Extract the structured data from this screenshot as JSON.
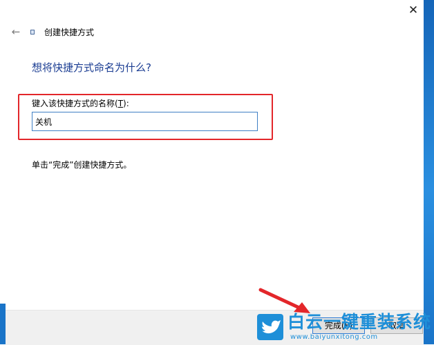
{
  "window": {
    "title": "创建快捷方式",
    "close_glyph": "✕",
    "back_glyph": "←"
  },
  "main": {
    "heading": "想将快捷方式命名为什么?",
    "field_label_pre": "键入该快捷方式的名称(",
    "field_label_key": "T",
    "field_label_post": "):",
    "name_value": "关机",
    "hint": "单击“完成”创建快捷方式。"
  },
  "footer": {
    "finish_label": "完成(F)",
    "cancel_label": "取消"
  },
  "watermark": {
    "title": "白云一键重装系统",
    "url": "www.baiyunxitong.com"
  },
  "colors": {
    "heading": "#1a3c92",
    "highlight": "#e3262a",
    "input_border": "#3e7fc4",
    "watermark": "#1e8fd8"
  },
  "icons": [
    "back-arrow-icon",
    "shortcut-icon",
    "close-icon",
    "bird-icon"
  ]
}
